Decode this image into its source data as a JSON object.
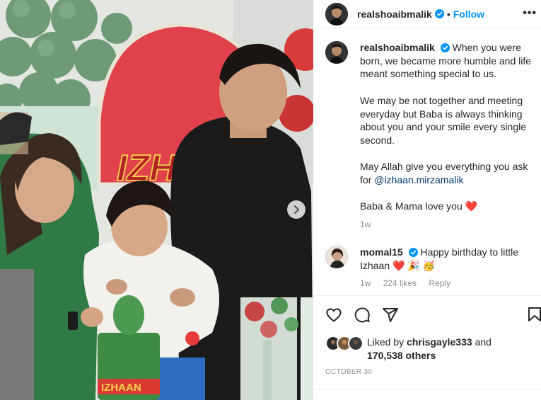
{
  "post": {
    "username": "realshoaibmalik",
    "follow_label": "Follow",
    "separator": "•",
    "more_label": "•••"
  },
  "caption": {
    "username": "realshoaibmalik",
    "para1": "When you were born, we became more humble and life meant something special to us.",
    "para2": "We may be not together and meeting everyday but Baba is always thinking about you and your smile every single second.",
    "para3_prefix": "May Allah give you everything you ask for ",
    "mention": "@izhaan.mirzamalik",
    "para4": "Baba & Mama love you",
    "para4_emoji": "❤️",
    "time": "1w"
  },
  "comment": {
    "username": "momal15",
    "text": "Happy birthday to little Izhaan",
    "emojis": "❤️ 🎉 🥳",
    "time": "1w",
    "likes": "224 likes",
    "reply": "Reply"
  },
  "likes": {
    "prefix": "Liked by",
    "user": "chrisgayle333",
    "joiner": "and",
    "count": "170,538 others"
  },
  "date": "OCTOBER 30",
  "photo": {
    "banner_text": "IZH",
    "cake_text": "IZHAAN"
  },
  "colors": {
    "link": "#0095f6",
    "mention": "#00376b",
    "verified": "#0095f6",
    "muted": "#8e8e8e"
  },
  "icons": [
    "verified-badge-icon",
    "more-options-icon",
    "heart-icon",
    "comment-icon",
    "share-icon",
    "bookmark-icon",
    "chevron-right-icon"
  ]
}
